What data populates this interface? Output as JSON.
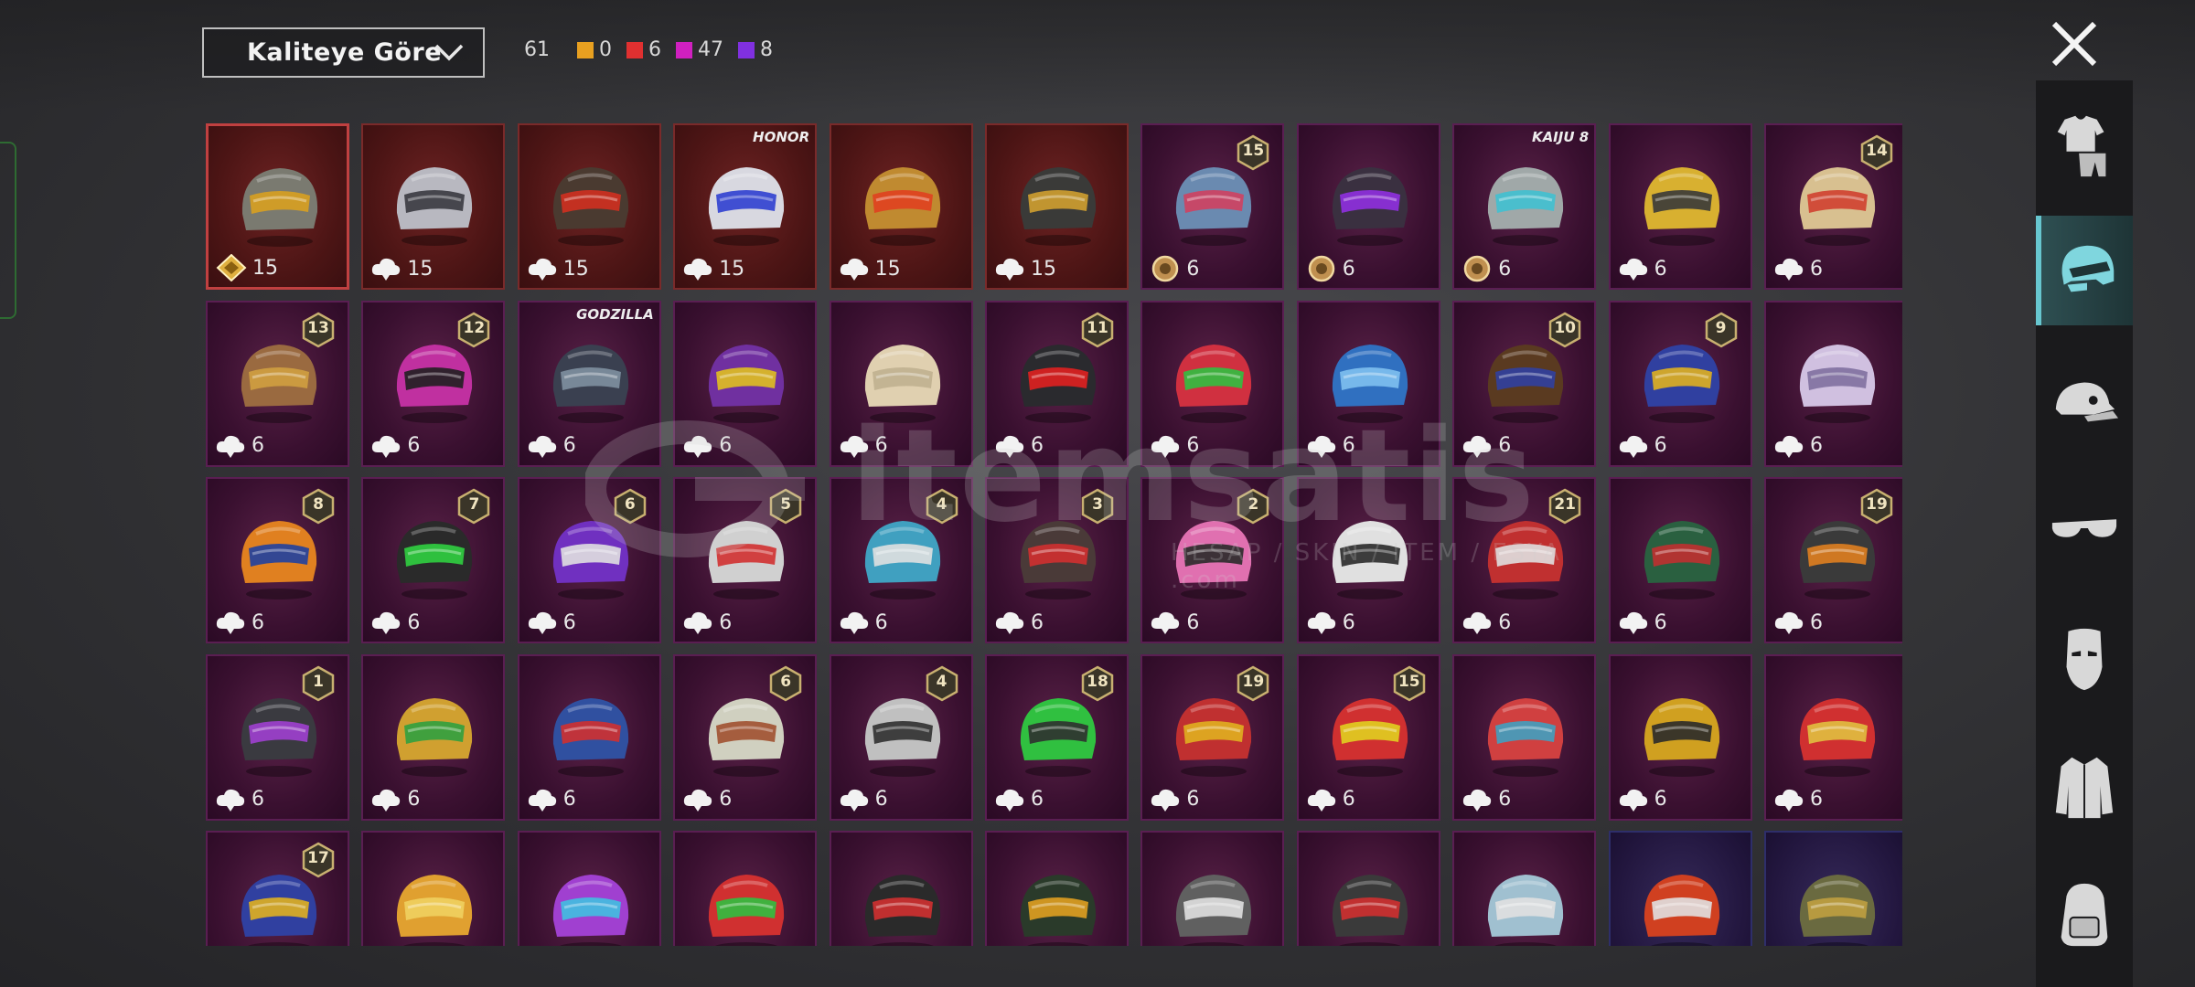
{
  "header": {
    "sort_label": "Kaliteye Göre",
    "counts": [
      {
        "value": "61",
        "color": ""
      },
      {
        "value": "0",
        "color": "#e8a020"
      },
      {
        "value": "6",
        "color": "#e03030"
      },
      {
        "value": "47",
        "color": "#d020c0"
      },
      {
        "value": "8",
        "color": "#8030e0"
      }
    ]
  },
  "watermark": {
    "brand": "itemsatis",
    "sub": "HESAP / SKIN / ITEM / ESYA .com"
  },
  "sidebar": {
    "items": [
      {
        "name": "outfit",
        "icon": "outfit-icon"
      },
      {
        "name": "helmet",
        "icon": "helmet-icon",
        "active": true
      },
      {
        "name": "hat",
        "icon": "cap-icon"
      },
      {
        "name": "glasses",
        "icon": "glasses-icon"
      },
      {
        "name": "mask",
        "icon": "mask-icon"
      },
      {
        "name": "jacket",
        "icon": "jacket-icon"
      },
      {
        "name": "backpack",
        "icon": "backpack-icon"
      }
    ]
  },
  "items": [
    {
      "color": "#7a7a70",
      "accent": "#d8a020",
      "cost": "15",
      "cost_icon": "gem",
      "frame": "red"
    },
    {
      "color": "#b8b8c0",
      "accent": "#3a3a40",
      "cost": "15",
      "cost_icon": "cloud",
      "frame": "red"
    },
    {
      "color": "#4a3a30",
      "accent": "#d03020",
      "cost": "15",
      "cost_icon": "cloud",
      "frame": "red"
    },
    {
      "color": "#d8d8e0",
      "accent": "#3040d0",
      "cost": "15",
      "cost_icon": "cloud",
      "frame": "red",
      "tag": "HONOR"
    },
    {
      "color": "#c08a30",
      "accent": "#e04020",
      "cost": "15",
      "cost_icon": "cloud",
      "frame": "red"
    },
    {
      "color": "#3a3a38",
      "accent": "#d0a030",
      "cost": "15",
      "cost_icon": "cloud",
      "frame": "red"
    },
    {
      "color": "#6a8ab0",
      "accent": "#d04060",
      "cost": "6",
      "cost_icon": "coin",
      "level": "15"
    },
    {
      "color": "#3a3040",
      "accent": "#9030e0",
      "cost": "6",
      "cost_icon": "coin"
    },
    {
      "color": "#a0a8a8",
      "accent": "#40c0d0",
      "cost": "6",
      "cost_icon": "coin",
      "tag": "KAIJU 8"
    },
    {
      "color": "#d8b030",
      "accent": "#3a3a3a",
      "cost": "6",
      "cost_icon": "cloud"
    },
    {
      "color": "#d8c090",
      "accent": "#d04030",
      "cost": "6",
      "cost_icon": "cloud",
      "level": "14"
    },
    {
      "color": "#9a6a40",
      "accent": "#d0a040",
      "cost": "6",
      "cost_icon": "cloud",
      "level": "13"
    },
    {
      "color": "#c030a0",
      "accent": "#202020",
      "cost": "6",
      "cost_icon": "cloud",
      "level": "12"
    },
    {
      "color": "#3a4050",
      "accent": "#8090a0",
      "cost": "6",
      "cost_icon": "cloud",
      "tag": "GODZILLA"
    },
    {
      "color": "#7030a0",
      "accent": "#e0c020",
      "cost": "6",
      "cost_icon": "cloud"
    },
    {
      "color": "#e0d0b0",
      "accent": "#c0b090",
      "cost": "6",
      "cost_icon": "cloud"
    },
    {
      "color": "#2a2a2e",
      "accent": "#e02020",
      "cost": "6",
      "cost_icon": "cloud",
      "level": "11"
    },
    {
      "color": "#d03040",
      "accent": "#30c040",
      "cost": "6",
      "cost_icon": "cloud"
    },
    {
      "color": "#3070c0",
      "accent": "#80c0f0",
      "cost": "6",
      "cost_icon": "cloud"
    },
    {
      "color": "#5a3a20",
      "accent": "#3040a0",
      "cost": "6",
      "cost_icon": "cloud",
      "level": "10"
    },
    {
      "color": "#3040a0",
      "accent": "#e0b020",
      "cost": "6",
      "cost_icon": "cloud",
      "level": "9"
    },
    {
      "color": "#d0c0e0",
      "accent": "#8070a0",
      "cost": "6",
      "cost_icon": "cloud"
    },
    {
      "color": "#e08020",
      "accent": "#2040a0",
      "cost": "6",
      "cost_icon": "cloud",
      "level": "8"
    },
    {
      "color": "#2a2a2a",
      "accent": "#30d040",
      "cost": "6",
      "cost_icon": "cloud",
      "level": "7"
    },
    {
      "color": "#7030c0",
      "accent": "#e0e0e0",
      "cost": "6",
      "cost_icon": "cloud",
      "level": "6"
    },
    {
      "color": "#d0d0d0",
      "accent": "#d03030",
      "cost": "6",
      "cost_icon": "cloud",
      "level": "5"
    },
    {
      "color": "#40a0c0",
      "accent": "#e0e0e0",
      "cost": "6",
      "cost_icon": "cloud",
      "level": "4"
    },
    {
      "color": "#4a3a38",
      "accent": "#d03030",
      "cost": "6",
      "cost_icon": "cloud",
      "level": "3"
    },
    {
      "color": "#e070b0",
      "accent": "#2a2a2a",
      "cost": "6",
      "cost_icon": "cloud",
      "level": "2"
    },
    {
      "color": "#e0e0e0",
      "accent": "#2a2a2a",
      "cost": "6",
      "cost_icon": "cloud"
    },
    {
      "color": "#c03030",
      "accent": "#e0e0e0",
      "cost": "6",
      "cost_icon": "cloud",
      "level": "21"
    },
    {
      "color": "#2a6040",
      "accent": "#c03030",
      "cost": "6",
      "cost_icon": "cloud"
    },
    {
      "color": "#3a3a3a",
      "accent": "#e08020",
      "cost": "6",
      "cost_icon": "cloud",
      "level": "19"
    },
    {
      "color": "#3a3a40",
      "accent": "#a040d0",
      "cost": "6",
      "cost_icon": "cloud",
      "level": "1"
    },
    {
      "color": "#d0a030",
      "accent": "#30a040",
      "cost": "6",
      "cost_icon": "cloud"
    },
    {
      "color": "#3050a0",
      "accent": "#d03030",
      "cost": "6",
      "cost_icon": "cloud"
    },
    {
      "color": "#d0d0c0",
      "accent": "#a05030",
      "cost": "6",
      "cost_icon": "cloud",
      "level": "6"
    },
    {
      "color": "#c0c0c0",
      "accent": "#303030",
      "cost": "6",
      "cost_icon": "cloud",
      "level": "4"
    },
    {
      "color": "#30c040",
      "accent": "#303030",
      "cost": "6",
      "cost_icon": "cloud",
      "level": "18"
    },
    {
      "color": "#c03030",
      "accent": "#e0b020",
      "cost": "6",
      "cost_icon": "cloud",
      "level": "19"
    },
    {
      "color": "#d03030",
      "accent": "#e0d020",
      "cost": "6",
      "cost_icon": "cloud",
      "level": "15"
    },
    {
      "color": "#d04040",
      "accent": "#40a0c0",
      "cost": "6",
      "cost_icon": "cloud"
    },
    {
      "color": "#d0a020",
      "accent": "#2a2a2a",
      "cost": "6",
      "cost_icon": "cloud"
    },
    {
      "color": "#d03030",
      "accent": "#e0c040",
      "cost": "6",
      "cost_icon": "cloud"
    },
    {
      "color": "#3040a0",
      "accent": "#e0b020",
      "level": "17"
    },
    {
      "color": "#e0a030",
      "accent": "#f0d060"
    },
    {
      "color": "#a040d0",
      "accent": "#40c0e0"
    },
    {
      "color": "#d03030",
      "accent": "#30c040"
    },
    {
      "color": "#2a2a2a",
      "accent": "#d03030"
    },
    {
      "color": "#2a3a2a",
      "accent": "#e0a020"
    },
    {
      "color": "#606060",
      "accent": "#e0e0e0"
    },
    {
      "color": "#3a3a3a",
      "accent": "#d03030"
    },
    {
      "color": "#a0c0d0",
      "accent": "#e0e0e0"
    },
    {
      "color": "#d04020",
      "accent": "#e0e0e0",
      "frame": "blue"
    },
    {
      "color": "#6a6a40",
      "accent": "#c0a040",
      "frame": "blue"
    }
  ]
}
